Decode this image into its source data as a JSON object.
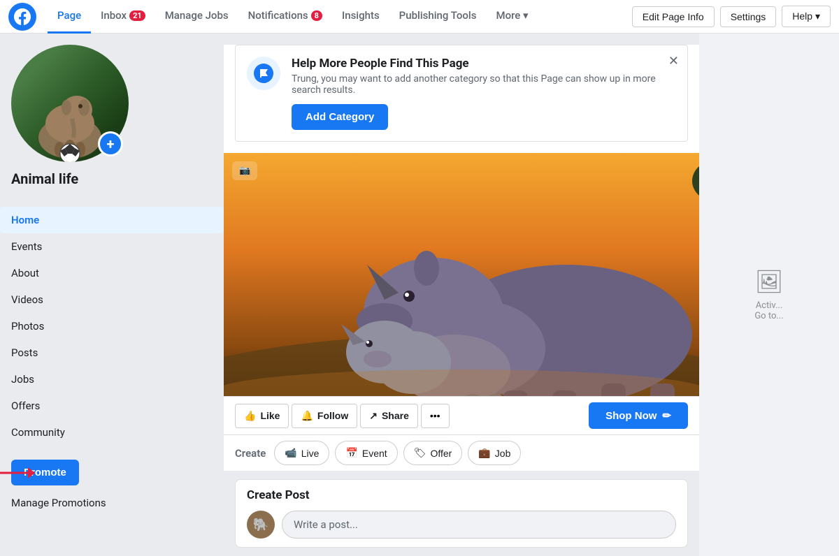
{
  "nav": {
    "tabs": [
      {
        "id": "page",
        "label": "Page",
        "active": true,
        "badge": null
      },
      {
        "id": "inbox",
        "label": "Inbox",
        "active": false,
        "badge": "21"
      },
      {
        "id": "manage-jobs",
        "label": "Manage Jobs",
        "active": false,
        "badge": null
      },
      {
        "id": "notifications",
        "label": "Notifications",
        "active": false,
        "badge": "8"
      },
      {
        "id": "insights",
        "label": "Insights",
        "active": false,
        "badge": null
      },
      {
        "id": "publishing-tools",
        "label": "Publishing Tools",
        "active": false,
        "badge": null
      },
      {
        "id": "more",
        "label": "More ▾",
        "active": false,
        "badge": null
      }
    ],
    "right_buttons": [
      {
        "id": "edit-page-info",
        "label": "Edit Page Info"
      },
      {
        "id": "settings",
        "label": "Settings"
      },
      {
        "id": "help",
        "label": "Help ▾"
      }
    ]
  },
  "sidebar": {
    "page_name": "Animal life",
    "menu_items": [
      {
        "id": "home",
        "label": "Home",
        "active": true
      },
      {
        "id": "events",
        "label": "Events",
        "active": false
      },
      {
        "id": "about",
        "label": "About",
        "active": false
      },
      {
        "id": "videos",
        "label": "Videos",
        "active": false
      },
      {
        "id": "photos",
        "label": "Photos",
        "active": false
      },
      {
        "id": "posts",
        "label": "Posts",
        "active": false
      },
      {
        "id": "jobs",
        "label": "Jobs",
        "active": false
      },
      {
        "id": "offers",
        "label": "Offers",
        "active": false
      },
      {
        "id": "community",
        "label": "Community",
        "active": false
      }
    ],
    "promote_label": "Promote",
    "manage_promotions_label": "Manage Promotions"
  },
  "notification_banner": {
    "title": "Help More People Find This Page",
    "description": "Trung, you may want to add another category so that this Page can show up in more search results.",
    "button_label": "Add Category"
  },
  "action_bar": {
    "like_label": "Like",
    "follow_label": "Follow",
    "share_label": "Share",
    "shop_now_label": "Shop Now"
  },
  "create_bar": {
    "label": "Create",
    "buttons": [
      {
        "id": "live",
        "label": "Live",
        "icon": "▶"
      },
      {
        "id": "event",
        "label": "Event",
        "icon": "📅"
      },
      {
        "id": "offer",
        "label": "Offer",
        "icon": "🏷"
      },
      {
        "id": "job",
        "label": "Job",
        "icon": "💼"
      }
    ]
  },
  "create_post": {
    "header": "Create Post",
    "placeholder": "Write a post..."
  },
  "right_sidebar": {
    "icon": "🖼",
    "text": "Activ...\nGo to..."
  }
}
